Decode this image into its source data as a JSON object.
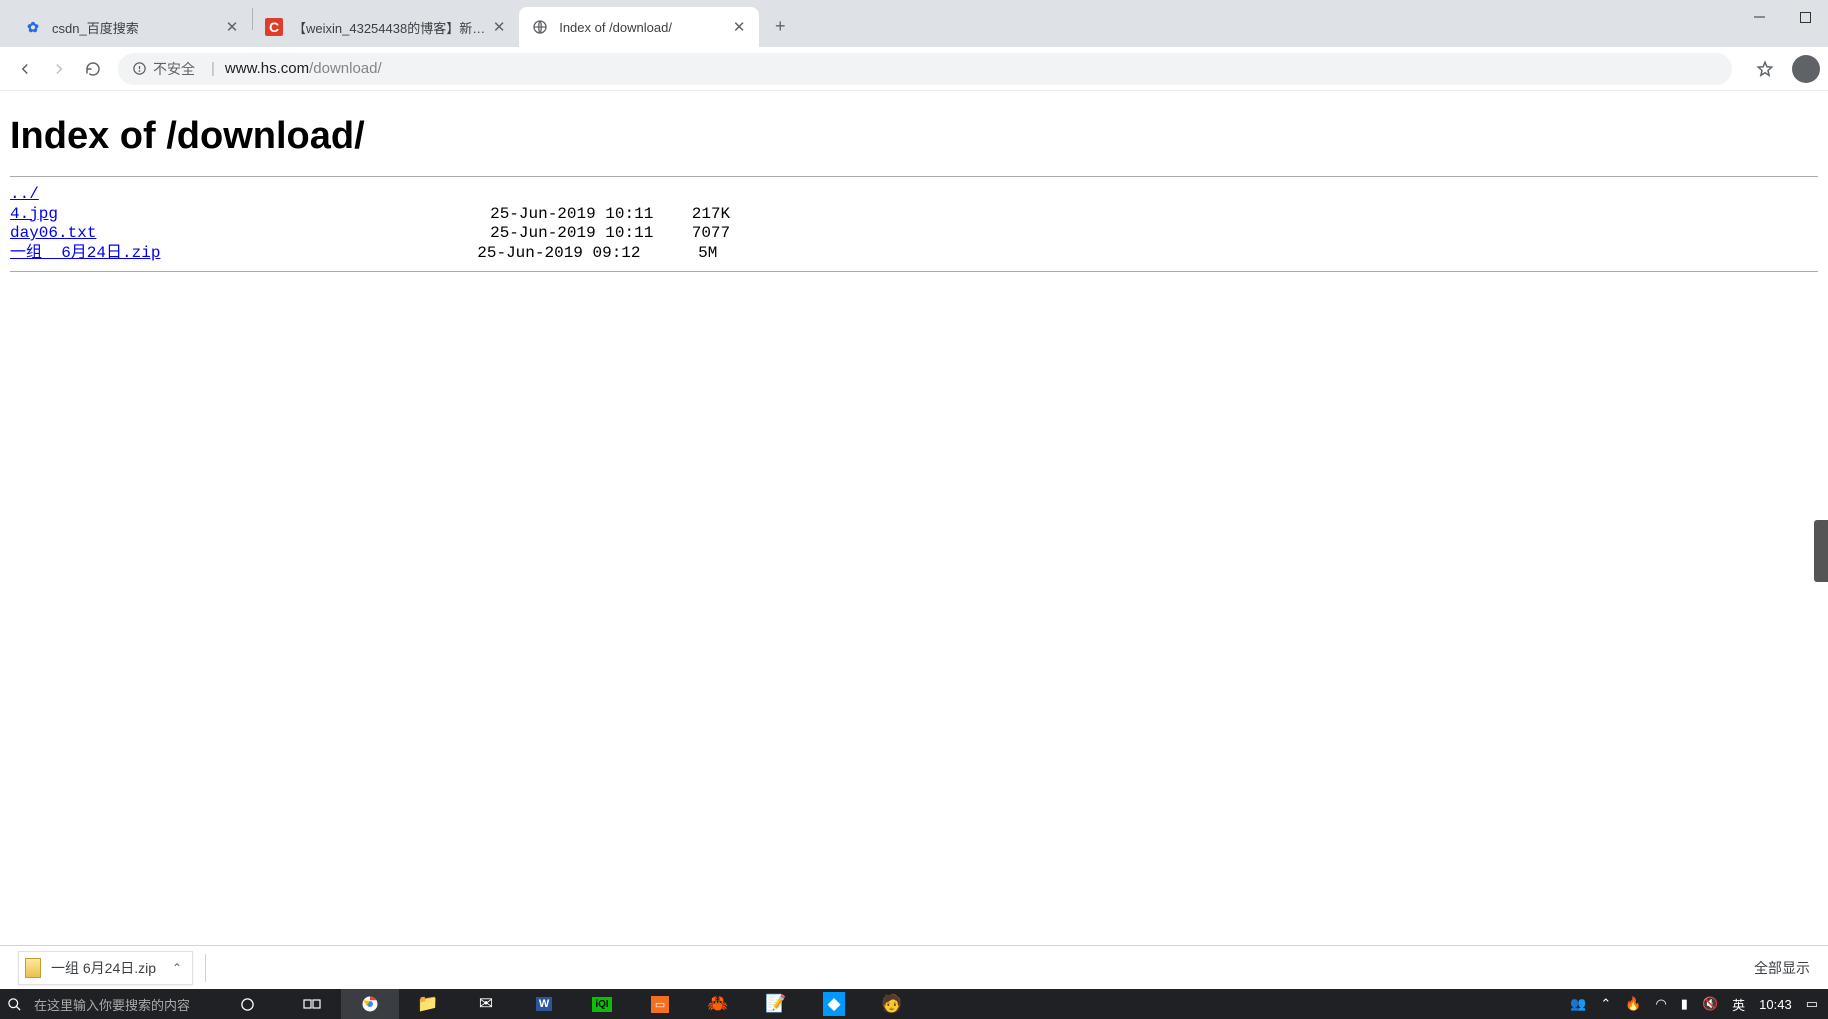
{
  "window": {
    "minimize": "–",
    "maximize": "☐",
    "close": "✕"
  },
  "tabs": [
    {
      "title": "csdn_百度搜索",
      "favicon": "baidu"
    },
    {
      "title": "【weixin_43254438的博客】新…",
      "favicon": "csdn"
    },
    {
      "title": "Index of /download/",
      "favicon": "globe",
      "active": true
    }
  ],
  "new_tab": "+",
  "omnibox": {
    "insecure_label": "不安全",
    "host": "www.hs.com",
    "path": "/download/"
  },
  "page": {
    "heading": "Index of /download/",
    "parent": "../",
    "files": [
      {
        "name": "4.jpg",
        "date": "25-Jun-2019 10:11",
        "size": "217K"
      },
      {
        "name": "day06.txt",
        "date": "25-Jun-2019 10:11",
        "size": "7077"
      },
      {
        "name": "一组  6月24日.zip",
        "date": "25-Jun-2019 09:12",
        "size": "5M"
      }
    ]
  },
  "download_shelf": {
    "item": "一组  6月24日.zip",
    "show_all": "全部显示"
  },
  "taskbar": {
    "search_placeholder": "在这里输入你要搜索的内容",
    "clock": "10:43",
    "ime": "英"
  }
}
